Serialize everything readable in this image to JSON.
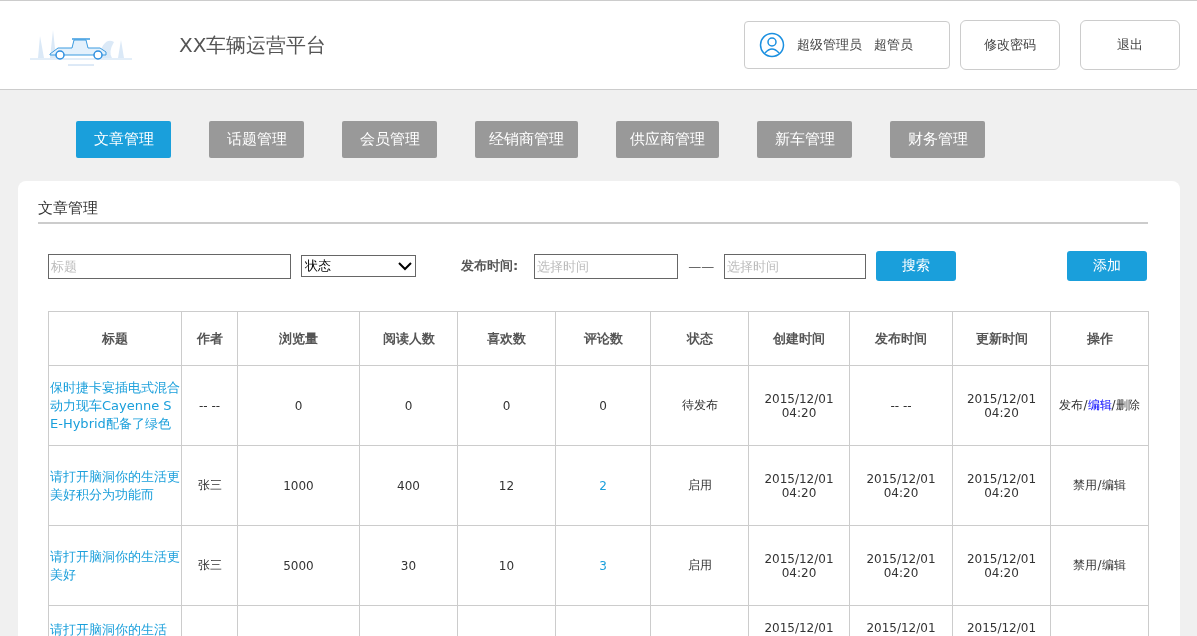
{
  "header": {
    "title": "XX车辆运营平台",
    "user": {
      "role": "超级管理员",
      "name": "超管员"
    },
    "buttons": [
      "修改密码",
      "退出"
    ]
  },
  "nav": [
    {
      "label": "文章管理",
      "selected": true
    },
    {
      "label": "话题管理",
      "selected": false
    },
    {
      "label": "会员管理",
      "selected": false
    },
    {
      "label": "经销商管理",
      "selected": false
    },
    {
      "label": "供应商管理",
      "selected": false
    },
    {
      "label": "新车管理",
      "selected": false
    },
    {
      "label": "财务管理",
      "selected": false
    }
  ],
  "panel": {
    "title": "文章管理",
    "filters": {
      "title_placeholder": "标题",
      "status": "状态",
      "time_label": "发布时间:",
      "start_placeholder": "选择时间",
      "separator": "——",
      "end_placeholder": "选择时间",
      "search": "搜索",
      "add": "添加"
    },
    "table": {
      "columns": [
        "标题",
        "作者",
        "浏览量",
        "阅读人数",
        "喜欢数",
        "评论数",
        "状态",
        "创建时间",
        "发布时间",
        "更新时间",
        "操作"
      ],
      "rows": [
        {
          "title": "保时捷卡宴插电式混合动力现车Cayenne S E-Hybrid配备了绿色",
          "author": "-- --",
          "views": "0",
          "readers": "0",
          "likes": "0",
          "comments": {
            "text": "0",
            "link": false
          },
          "status": "待发布",
          "created": "2015/12/01 04:20",
          "published": "-- --",
          "updated": "2015/12/01 04:20",
          "actions": [
            {
              "text": "发布/",
              "highlighted": false
            },
            {
              "text": "编辑",
              "highlighted": true
            },
            {
              "text": "/删除",
              "highlighted": false
            }
          ]
        },
        {
          "title": "请打开脑洞你的生活更美好积分为功能而",
          "author": "张三",
          "views": "1000",
          "readers": "400",
          "likes": "12",
          "comments": {
            "text": "2",
            "link": true
          },
          "status": "启用",
          "created": "2015/12/01 04:20",
          "published": "2015/12/01 04:20",
          "updated": "2015/12/01 04:20",
          "actions": [
            {
              "text": "禁用/编辑",
              "highlighted": false
            }
          ]
        },
        {
          "title": "请打开脑洞你的生活更美好",
          "author": "张三",
          "views": "5000",
          "readers": "30",
          "likes": "10",
          "comments": {
            "text": "3",
            "link": true
          },
          "status": "启用",
          "created": "2015/12/01 04:20",
          "published": "2015/12/01 04:20",
          "updated": "2015/12/01 04:20",
          "actions": [
            {
              "text": "禁用/编辑",
              "highlighted": false
            }
          ]
        },
        {
          "title": "请打开脑洞你的生活",
          "created": "2015/12/01",
          "published": "2015/12/01",
          "updated": "2015/12/01"
        }
      ]
    }
  }
}
